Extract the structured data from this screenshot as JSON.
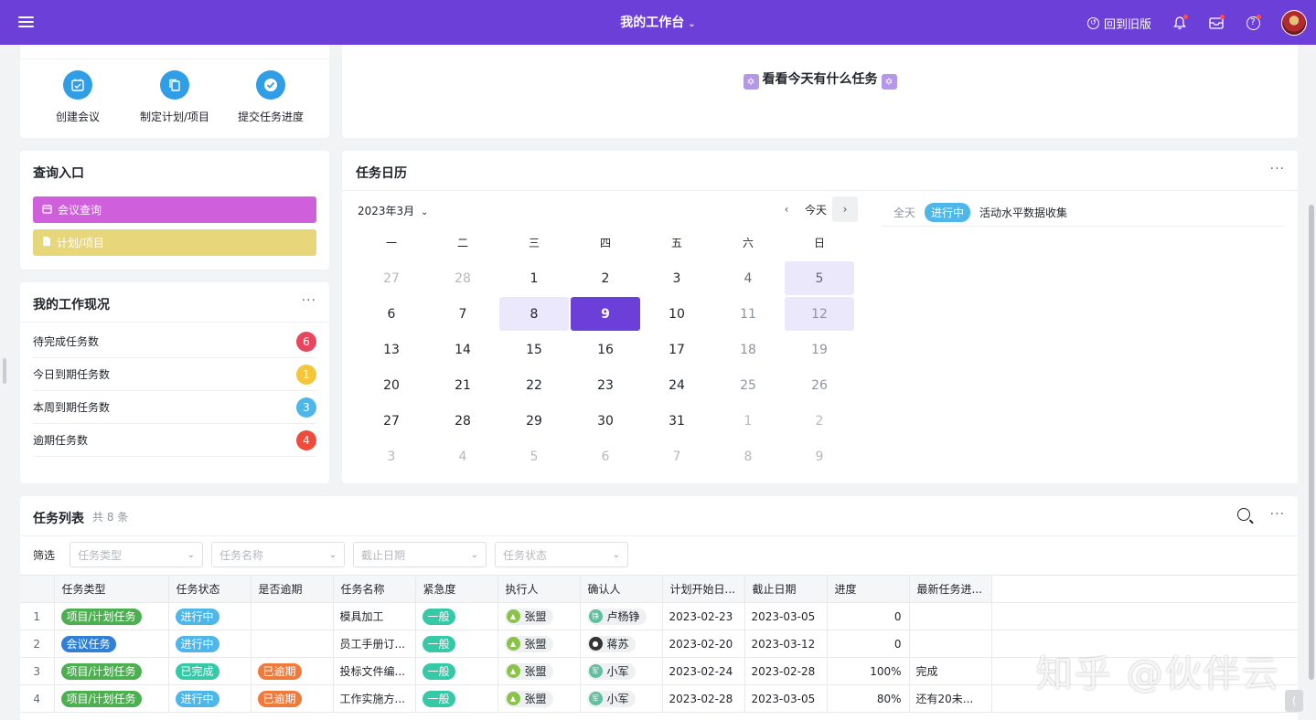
{
  "topbar": {
    "title": "我的工作台",
    "back_old": "回到旧版"
  },
  "quick_actions": [
    {
      "label": "创建会议",
      "icon": "calendar-check-icon"
    },
    {
      "label": "制定计划/项目",
      "icon": "copy-icon"
    },
    {
      "label": "提交任务进度",
      "icon": "check-circle-icon"
    }
  ],
  "banner": {
    "text": "看看今天有什么任务"
  },
  "query": {
    "title": "查询入口",
    "buttons": [
      {
        "label": "会议查询",
        "color": "#cf5fdb"
      },
      {
        "label": "计划/项目",
        "color": "#e8d77a"
      }
    ]
  },
  "status": {
    "title": "我的工作现况",
    "rows": [
      {
        "label": "待完成任务数",
        "count": "6",
        "color": "#e8455f"
      },
      {
        "label": "今日到期任务数",
        "count": "1",
        "color": "#f5c53a"
      },
      {
        "label": "本周到期任务数",
        "count": "3",
        "color": "#4fb6ea"
      },
      {
        "label": "逾期任务数",
        "count": "4",
        "color": "#ef4b3c"
      }
    ]
  },
  "calendar": {
    "title": "任务日历",
    "month": "2023年3月",
    "today_label": "今天",
    "weekdays": [
      "一",
      "二",
      "三",
      "四",
      "五",
      "六",
      "日"
    ],
    "weeks": [
      [
        "27",
        "28",
        "1",
        "2",
        "3",
        "4",
        "5"
      ],
      [
        "6",
        "7",
        "8",
        "9",
        "10",
        "11",
        "12"
      ],
      [
        "13",
        "14",
        "15",
        "16",
        "17",
        "18",
        "19"
      ],
      [
        "20",
        "21",
        "22",
        "23",
        "24",
        "25",
        "26"
      ],
      [
        "27",
        "28",
        "29",
        "30",
        "31",
        "1",
        "2"
      ],
      [
        "3",
        "4",
        "5",
        "6",
        "7",
        "8",
        "9"
      ]
    ],
    "event": {
      "allday": "全天",
      "status": "进行中",
      "name": "活动水平数据收集"
    }
  },
  "tasks": {
    "title": "任务列表",
    "count_text": "共 8 条",
    "filter_label": "筛选",
    "filters": [
      "任务类型",
      "任务名称",
      "截止日期",
      "任务状态"
    ],
    "columns": [
      "任务类型",
      "任务状态",
      "是否逾期",
      "任务名称",
      "紧急度",
      "执行人",
      "确认人",
      "计划开始日...",
      "截止日期",
      "进度",
      "最新任务进..."
    ],
    "rows": [
      {
        "no": "1",
        "type": "项目/计划任务",
        "status": "进行中",
        "overdue": "",
        "name": "模具加工",
        "urgency": "一般",
        "exec": "张盟",
        "confirm": "卢杨铮",
        "start": "2023-02-23",
        "due": "2023-03-05",
        "progress": "0",
        "latest": ""
      },
      {
        "no": "2",
        "type": "会议任务",
        "status": "进行中",
        "overdue": "",
        "name": "员工手册订...",
        "urgency": "一般",
        "exec": "张盟",
        "confirm": "蒋苏",
        "start": "2023-02-20",
        "due": "2023-03-12",
        "progress": "0",
        "latest": ""
      },
      {
        "no": "3",
        "type": "项目/计划任务",
        "status": "已完成",
        "overdue": "已逾期",
        "name": "投标文件编...",
        "urgency": "一般",
        "exec": "张盟",
        "confirm": "小军",
        "start": "2023-02-24",
        "due": "2023-02-28",
        "progress": "100%",
        "latest": "完成"
      },
      {
        "no": "4",
        "type": "项目/计划任务",
        "status": "进行中",
        "overdue": "已逾期",
        "name": "工作实施方...",
        "urgency": "一般",
        "exec": "张盟",
        "confirm": "小军",
        "start": "2023-02-28",
        "due": "2023-03-05",
        "progress": "80%",
        "latest": "还有20未..."
      }
    ]
  },
  "watermark": "知乎 @伙伴云",
  "colors": {
    "brand": "#6c3fd8",
    "green": "#4caf50",
    "blue": "#4fb6ea",
    "orange": "#f07a3c",
    "teal": "#36c9a8"
  }
}
